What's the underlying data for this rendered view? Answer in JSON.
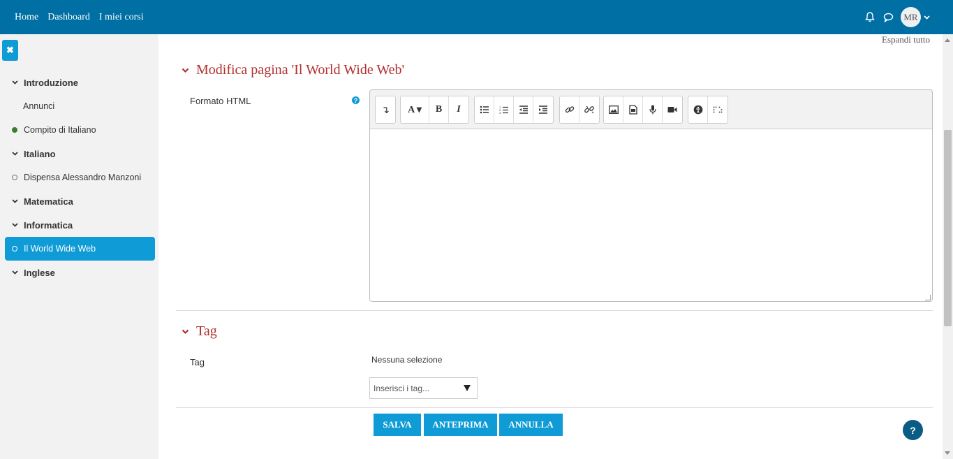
{
  "topbar": {
    "nav": [
      "Home",
      "Dashboard",
      "I miei corsi"
    ],
    "user_initials": "MR",
    "bell_icon": "bell-icon",
    "chat_icon": "chat-icon",
    "color": "#006fa3"
  },
  "sidebar": {
    "close_icon": "close-icon",
    "items": [
      {
        "label": "Introduzione",
        "type": "section"
      },
      {
        "label": "Annunci",
        "type": "leaf"
      },
      {
        "label": "Compito di Italiano",
        "type": "activity",
        "status": "done"
      },
      {
        "label": "Italiano",
        "type": "section"
      },
      {
        "label": "Dispensa Alessandro Manzoni",
        "type": "activity",
        "status": "todo"
      },
      {
        "label": "Matematica",
        "type": "section"
      },
      {
        "label": "Informatica",
        "type": "section"
      },
      {
        "label": "Il World Wide Web",
        "type": "activity",
        "status": "todo",
        "active": true
      },
      {
        "label": "Inglese",
        "type": "section"
      }
    ]
  },
  "main": {
    "expand_all": "Espandi tutto",
    "section_edit_title": "Modifica pagina 'Il World Wide Web'",
    "html_label": "Formato HTML",
    "help_icon": "help-icon",
    "section_tag_title": "Tag",
    "tag_label": "Tag",
    "tag_no_selection": "Nessuna selezione",
    "tag_placeholder": "Inserisci i tag...",
    "buttons": {
      "save": "SALVA",
      "preview": "ANTEPRIMA",
      "cancel": "ANNULLA"
    },
    "accent": "#0f9bd6",
    "section_color": "#b22f2f"
  },
  "editor_toolbar": [
    [
      "show-more-icon"
    ],
    [
      "font-style-icon",
      "bold-icon",
      "italic-icon"
    ],
    [
      "bullet-list-icon",
      "numbered-list-icon",
      "outdent-icon",
      "indent-icon"
    ],
    [
      "link-icon",
      "unlink-icon"
    ],
    [
      "image-icon",
      "media-icon",
      "record-audio-icon",
      "record-video-icon"
    ],
    [
      "accessibility-checker-icon",
      "screenreader-helper-icon"
    ]
  ]
}
